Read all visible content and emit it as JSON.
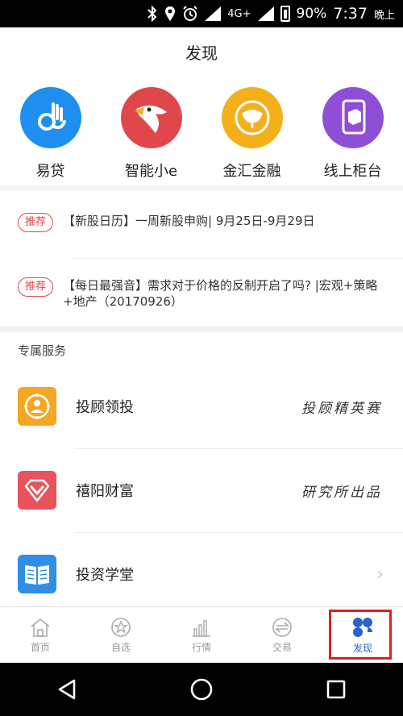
{
  "status_bar": {
    "network": "4G+",
    "battery": "90%",
    "time": "7:37",
    "period": "晚上"
  },
  "header": {
    "title": "发现"
  },
  "apps": [
    {
      "label": "易贷",
      "icon": "ok-hand-icon",
      "color": "#1e8ef0"
    },
    {
      "label": "智能小e",
      "icon": "eagle-icon",
      "color": "#e0474d"
    },
    {
      "label": "金汇金融",
      "icon": "ginkgo-icon",
      "color": "#f4b01b"
    },
    {
      "label": "线上柜台",
      "icon": "phone-box-icon",
      "color": "#8e4fd6"
    }
  ],
  "news": [
    {
      "badge": "推荐",
      "text": "【新股日历】一周新股申购|  9月25日-9月29日"
    },
    {
      "badge": "推荐",
      "text": "【每日最强音】需求对于价格的反制开启了吗? |宏观+策略+地产（20170926）"
    }
  ],
  "section": {
    "title": "专属服务"
  },
  "services": [
    {
      "name": "投顾领投",
      "right": "投顾精英赛",
      "icon": "person-target-icon",
      "color": "#f5a623"
    },
    {
      "name": "禧阳财富",
      "right": "研究所出品",
      "icon": "diamond-heart-icon",
      "color": "#e9545c"
    },
    {
      "name": "投资学堂",
      "right": "",
      "icon": "book-icon",
      "color": "#2f8fe8"
    }
  ],
  "tabs": [
    {
      "label": "首页",
      "icon": "home-icon"
    },
    {
      "label": "自选",
      "icon": "star-icon"
    },
    {
      "label": "行情",
      "icon": "chart-icon"
    },
    {
      "label": "交易",
      "icon": "exchange-icon"
    },
    {
      "label": "发现",
      "icon": "discover-icon",
      "active": true
    }
  ],
  "colors": {
    "accent_blue": "#2b63c9",
    "badge_red": "#e0474d",
    "highlight_red": "#e01e1e"
  }
}
